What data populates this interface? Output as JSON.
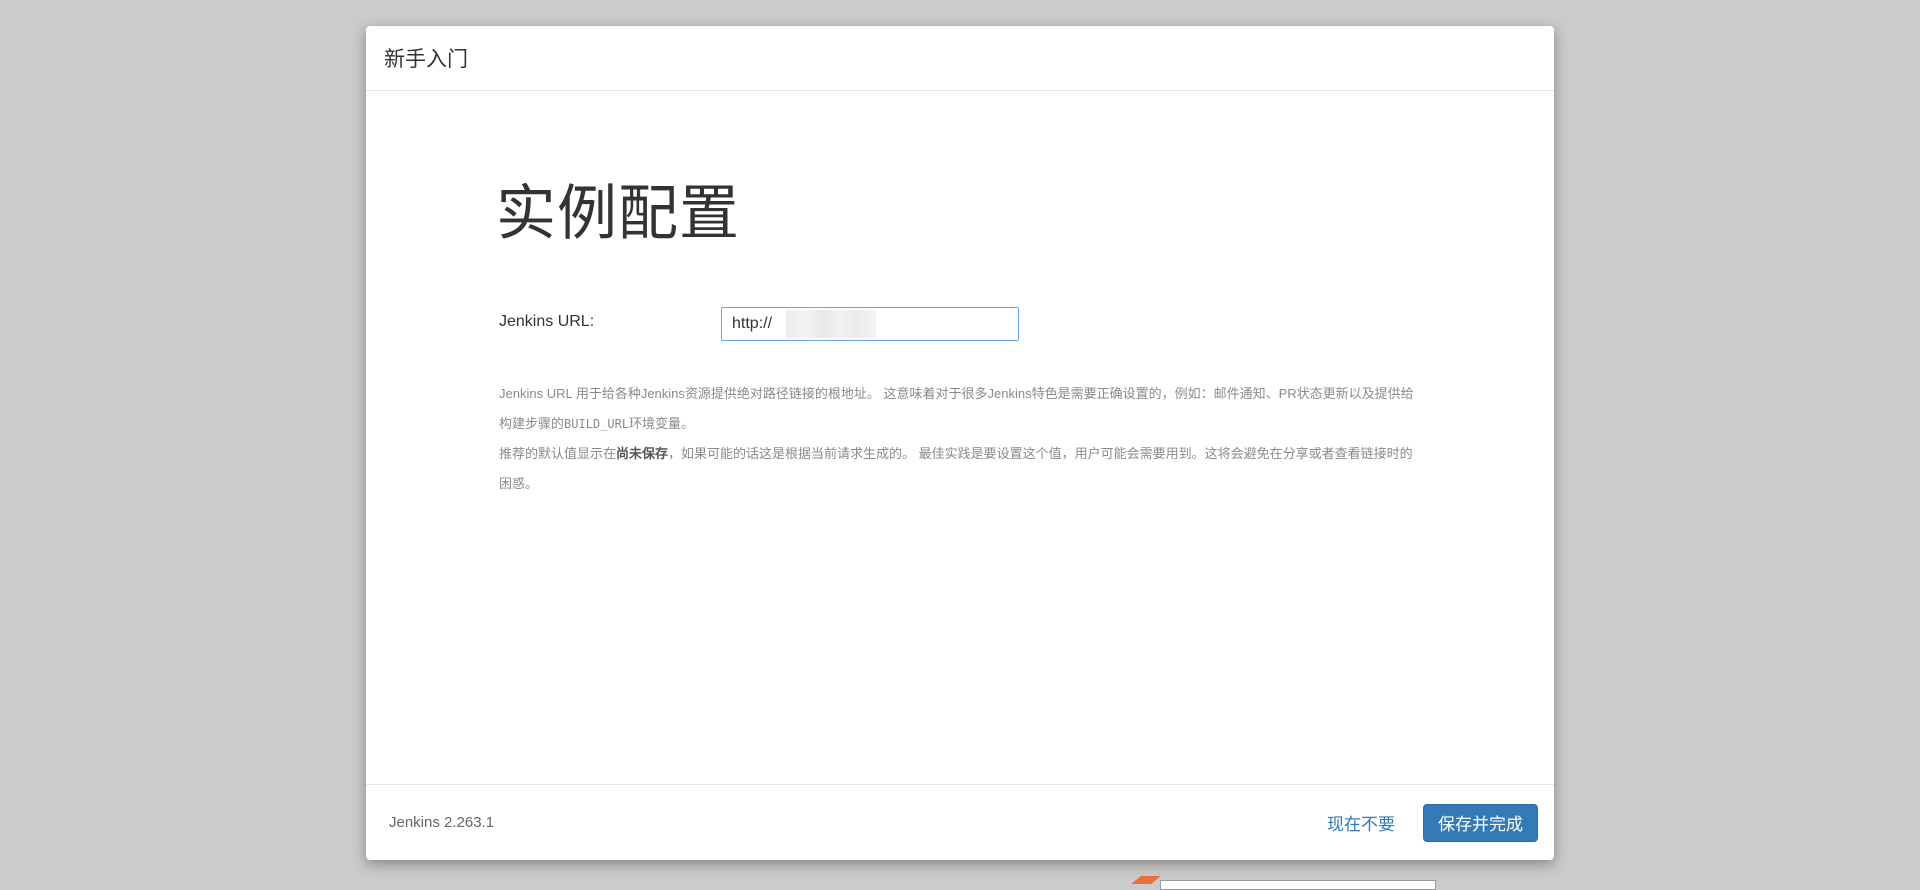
{
  "dialog": {
    "title": "新手入门",
    "heading": "实例配置"
  },
  "form": {
    "url_label": "Jenkins URL:",
    "url_value": "http://        68:8889/"
  },
  "help": {
    "p1_part1": "Jenkins URL 用于给各种Jenkins资源提供绝对路径链接的根地址。 这意味着对于很多Jenkins特色是需要正确设置的，例如：邮件通知、PR状态更新以及提供给构建步骤的",
    "p1_code": "BUILD_URL",
    "p1_part2": "环境变量。",
    "p2_part1": "推荐的默认值显示在",
    "p2_strong": "尚未保存",
    "p2_part2": "，如果可能的话这是根据当前请求生成的。 最佳实践是要设置这个值，用户可能会需要用到。这将会避免在分享或者查看链接时的困惑。"
  },
  "footer": {
    "version": "Jenkins 2.263.1",
    "skip_label": "现在不要",
    "save_label": "保存并完成"
  },
  "colors": {
    "primary": "#337ab7",
    "backdrop": "#cbcbcb"
  }
}
